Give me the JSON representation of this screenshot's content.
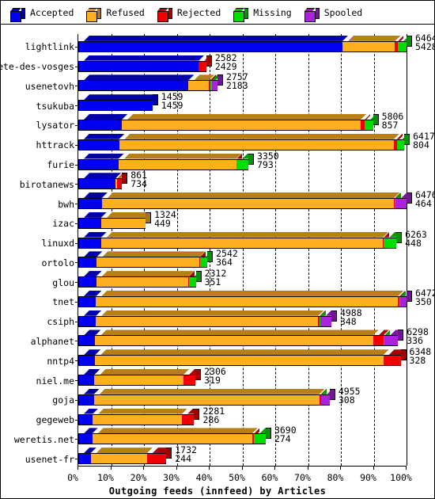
{
  "legend": {
    "items": [
      {
        "label": "Accepted",
        "color": "#0000f0",
        "icon": "cube-icon"
      },
      {
        "label": "Refused",
        "color": "#ffb020",
        "icon": "cube-icon"
      },
      {
        "label": "Rejected",
        "color": "#f00000",
        "icon": "cube-icon"
      },
      {
        "label": "Missing",
        "color": "#00dd00",
        "icon": "cube-icon"
      },
      {
        "label": "Spooled",
        "color": "#aa22dd",
        "icon": "cube-icon"
      }
    ]
  },
  "axis": {
    "x_ticks": [
      "0%",
      "10%",
      "20%",
      "30%",
      "40%",
      "50%",
      "60%",
      "70%",
      "80%",
      "90%",
      "100%"
    ],
    "x_title": "Outgoing feeds (innfeed) by Articles"
  },
  "chart_data": {
    "type": "bar",
    "orientation": "horizontal",
    "stacked": true,
    "normalized_percent": true,
    "title": "Outgoing feeds (innfeed) by Articles",
    "xlabel": "Outgoing feeds (innfeed) by Articles",
    "ylabel": "",
    "xlim": [
      0,
      100
    ],
    "xticks": [
      0,
      10,
      20,
      30,
      40,
      50,
      60,
      70,
      80,
      90,
      100
    ],
    "grid": "vertical-dashed",
    "legend_position": "top",
    "series": [
      {
        "name": "Accepted",
        "color": "#0000f0"
      },
      {
        "name": "Refused",
        "color": "#ffb020"
      },
      {
        "name": "Rejected",
        "color": "#f00000"
      },
      {
        "name": "Missing",
        "color": "#00dd00"
      },
      {
        "name": "Spooled",
        "color": "#aa22dd"
      }
    ],
    "categories": [
      "lightlink",
      "bete-des-vosges",
      "usenetovh",
      "tsukuba",
      "lysator",
      "httrack",
      "furie",
      "birotanews",
      "bwh",
      "izac",
      "linuxd",
      "ortolo",
      "glou",
      "tnet",
      "csiph",
      "alphanet",
      "nntp4",
      "niel.me",
      "goja",
      "gegeweb",
      "weretis.net",
      "usenet-fr"
    ],
    "rows": [
      {
        "label": "lightlink",
        "total": 6464,
        "accepted": 5428,
        "bar_percent": 100.0,
        "segments": [
          80.5,
          16.0,
          0.9,
          2.6,
          0.0
        ],
        "value_top": "6464",
        "value_bottom": "5428"
      },
      {
        "label": "bete-des-vosges",
        "total": 2582,
        "accepted": 2429,
        "bar_percent": 39.0,
        "segments": [
          94.1,
          0.0,
          5.9,
          0.0,
          0.0
        ],
        "value_top": "2582",
        "value_bottom": "2429"
      },
      {
        "label": "usenetovh",
        "total": 2757,
        "accepted": 2183,
        "bar_percent": 42.4,
        "segments": [
          79.2,
          14.5,
          1.0,
          1.2,
          4.1
        ],
        "value_top": "2757",
        "value_bottom": "2183"
      },
      {
        "label": "tsukuba",
        "total": 1459,
        "accepted": 1459,
        "bar_percent": 22.6,
        "segments": [
          100.0,
          0.0,
          0.0,
          0.0,
          0.0
        ],
        "value_top": "1459",
        "value_bottom": "1459"
      },
      {
        "label": "lysator",
        "total": 5806,
        "accepted": 857,
        "bar_percent": 89.8,
        "segments": [
          14.8,
          81.0,
          1.4,
          2.8,
          0.0
        ],
        "value_top": "5806",
        "value_bottom": "857"
      },
      {
        "label": "httrack",
        "total": 6417,
        "accepted": 804,
        "bar_percent": 99.3,
        "segments": [
          12.5,
          84.3,
          0.9,
          2.3,
          0.0
        ],
        "value_top": "6417",
        "value_bottom": "804"
      },
      {
        "label": "furie",
        "total": 3350,
        "accepted": 793,
        "bar_percent": 51.8,
        "segments": [
          23.7,
          69.2,
          0.3,
          6.8,
          0.0
        ],
        "value_top": "3350",
        "value_bottom": "793"
      },
      {
        "label": "birotanews",
        "total": 861,
        "accepted": 734,
        "bar_percent": 13.3,
        "segments": [
          85.2,
          3.5,
          11.3,
          0.0,
          0.0
        ],
        "value_top": "861",
        "value_bottom": "734"
      },
      {
        "label": "bwh",
        "total": 6476,
        "accepted": 464,
        "bar_percent": 100.0,
        "segments": [
          7.2,
          89.0,
          0.3,
          0.2,
          3.3
        ],
        "value_top": "6476",
        "value_bottom": "464"
      },
      {
        "label": "izac",
        "total": 1324,
        "accepted": 449,
        "bar_percent": 20.5,
        "segments": [
          33.9,
          66.1,
          0.0,
          0.0,
          0.0
        ],
        "value_top": "1324",
        "value_bottom": "449"
      },
      {
        "label": "linuxd",
        "total": 6263,
        "accepted": 448,
        "bar_percent": 96.9,
        "segments": [
          7.2,
          88.6,
          0.3,
          3.9,
          0.0
        ],
        "value_top": "6263",
        "value_bottom": "448"
      },
      {
        "label": "ortolo",
        "total": 2542,
        "accepted": 364,
        "bar_percent": 39.3,
        "segments": [
          14.3,
          79.8,
          0.3,
          5.6,
          0.0
        ],
        "value_top": "2542",
        "value_bottom": "364"
      },
      {
        "label": "glou",
        "total": 2312,
        "accepted": 351,
        "bar_percent": 35.8,
        "segments": [
          15.2,
          78.6,
          0.3,
          5.9,
          0.0
        ],
        "value_top": "2312",
        "value_bottom": "351"
      },
      {
        "label": "tnet",
        "total": 6472,
        "accepted": 350,
        "bar_percent": 100.0,
        "segments": [
          5.4,
          92.0,
          0.5,
          0.2,
          1.9
        ],
        "value_top": "6472",
        "value_bottom": "350"
      },
      {
        "label": "csiph",
        "total": 4988,
        "accepted": 348,
        "bar_percent": 77.1,
        "segments": [
          7.0,
          87.8,
          0.6,
          0.2,
          4.4
        ],
        "value_top": "4988",
        "value_bottom": "348"
      },
      {
        "label": "alphanet",
        "total": 6298,
        "accepted": 336,
        "bar_percent": 97.4,
        "segments": [
          5.3,
          86.9,
          3.2,
          0.4,
          4.2
        ],
        "value_top": "6298",
        "value_bottom": "336"
      },
      {
        "label": "nntp4",
        "total": 6348,
        "accepted": 328,
        "bar_percent": 98.2,
        "segments": [
          5.2,
          89.4,
          5.4,
          0.0,
          0.0
        ],
        "value_top": "6348",
        "value_bottom": "328"
      },
      {
        "label": "niel.me",
        "total": 2306,
        "accepted": 319,
        "bar_percent": 35.7,
        "segments": [
          13.8,
          76.0,
          10.2,
          0.0,
          0.0
        ],
        "value_top": "2306",
        "value_bottom": "319"
      },
      {
        "label": "goja",
        "total": 4955,
        "accepted": 308,
        "bar_percent": 76.6,
        "segments": [
          6.2,
          89.6,
          0.7,
          0.2,
          3.3
        ],
        "value_top": "4955",
        "value_bottom": "308"
      },
      {
        "label": "gegeweb",
        "total": 2281,
        "accepted": 286,
        "bar_percent": 35.3,
        "segments": [
          12.5,
          77.0,
          10.5,
          0.0,
          0.0
        ],
        "value_top": "2281",
        "value_bottom": "286"
      },
      {
        "label": "weretis.net",
        "total": 3690,
        "accepted": 274,
        "bar_percent": 57.1,
        "segments": [
          7.4,
          85.3,
          1.1,
          6.2,
          0.0
        ],
        "value_top": "3690",
        "value_bottom": "274"
      },
      {
        "label": "usenet-fr",
        "total": 1732,
        "accepted": 244,
        "bar_percent": 26.8,
        "segments": [
          14.1,
          64.0,
          21.9,
          0.0,
          0.0
        ],
        "value_top": "1732",
        "value_bottom": "244"
      }
    ]
  }
}
